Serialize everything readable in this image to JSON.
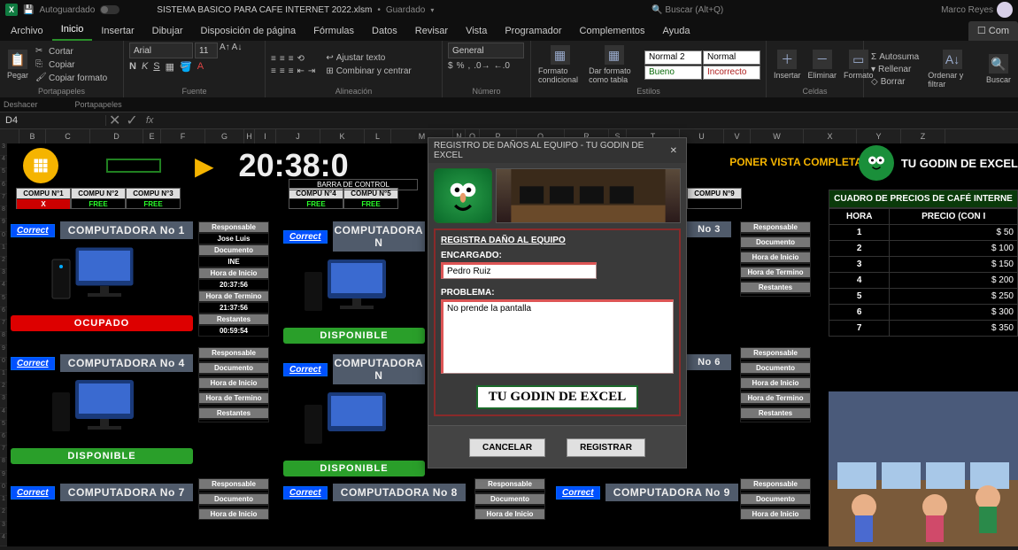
{
  "titlebar": {
    "autosave": "Autoguardado",
    "filename": "SISTEMA BASICO PARA CAFE INTERNET 2022.xlsm",
    "saved_state": "Guardado",
    "search_placeholder": "Buscar (Alt+Q)",
    "username": "Marco Reyes"
  },
  "tabs": [
    "Archivo",
    "Inicio",
    "Insertar",
    "Dibujar",
    "Disposición de página",
    "Fórmulas",
    "Datos",
    "Revisar",
    "Vista",
    "Programador",
    "Complementos",
    "Ayuda"
  ],
  "active_tab": "Inicio",
  "comments_btn": "Com",
  "ribbon": {
    "clipboard": {
      "paste": "Pegar",
      "cut": "Cortar",
      "copy": "Copiar",
      "format": "Copiar formato",
      "label": "Portapapeles"
    },
    "font": {
      "name": "Arial",
      "size": "11",
      "label": "Fuente"
    },
    "align": {
      "wrap": "Ajustar texto",
      "merge": "Combinar y centrar",
      "label": "Alineación"
    },
    "number": {
      "format": "General",
      "label": "Número"
    },
    "styles": {
      "cond": "Formato condicional",
      "table": "Dar formato como tabla",
      "s1": "Normal 2",
      "s2": "Normal",
      "s3": "Bueno",
      "s4": "Incorrecto",
      "label": "Estilos"
    },
    "cells": {
      "insert": "Insertar",
      "delete": "Eliminar",
      "format": "Formato",
      "label": "Celdas"
    },
    "editing": {
      "sum": "Autosuma",
      "fill": "Rellenar",
      "clear": "Borrar",
      "sort": "Ordenar y filtrar",
      "find": "Buscar",
      "label": ""
    }
  },
  "undo_label": "Deshacer",
  "namebox": "D4",
  "app": {
    "clock": "20:38:0",
    "view_full": "PONER VISTA COMPLETA",
    "brand": "TU GODIN DE EXCEL",
    "control_bar": "BARRA DE CONTROL",
    "correct_btn": "Correct",
    "status_ocupado": "OCUPADO",
    "status_disponible": "DISPONIBLE"
  },
  "compu_headers": [
    {
      "h": "COMPU N°1",
      "v": "X",
      "cls": "red"
    },
    {
      "h": "COMPU N°2",
      "v": "FREE",
      "cls": "grn"
    },
    {
      "h": "COMPU N°3",
      "v": "FREE",
      "cls": "grn"
    },
    {
      "h": "COMPU N°4",
      "v": "FREE",
      "cls": "grn"
    },
    {
      "h": "COMPU N°5",
      "v": "FREE",
      "cls": "grn"
    },
    {
      "h": "COMPU N°9",
      "v": "",
      "cls": ""
    }
  ],
  "sidebar_labels": [
    "Responsable",
    "Documento",
    "Hora de Inicio",
    "Hora de Termino",
    "Restantes"
  ],
  "pc1_side": {
    "resp": "Responsable",
    "resp_v": "Jose Luis",
    "doc": "Documento",
    "doc_v": "INE",
    "hi": "Hora de Inicio",
    "hi_v": "20:37:56",
    "ht": "Hora de Termino",
    "ht_v": "21:37:56",
    "rest": "Restantes",
    "rest_v": "00:59:54"
  },
  "panels": [
    {
      "title": "COMPUTADORA  No  1",
      "status": "OCUPADO"
    },
    {
      "title": "COMPUTADORA  N",
      "status": "DISPONIBLE"
    },
    {
      "title": "No  3",
      "status": ""
    },
    {
      "title": "COMPUTADORA  No  4",
      "status": "DISPONIBLE"
    },
    {
      "title": "COMPUTADORA  N",
      "status": "DISPONIBLE"
    },
    {
      "title": "No  6",
      "status": ""
    },
    {
      "title": "COMPUTADORA  No  7",
      "status": ""
    },
    {
      "title": "COMPUTADORA  No  8",
      "status": ""
    },
    {
      "title": "COMPUTADORA  No  9",
      "status": ""
    }
  ],
  "price_table": {
    "title": "CUADRO DE PRECIOS DE CAFÉ INTERNE",
    "col_hora": "HORA",
    "col_precio": "PRECIO (CON I",
    "rows": [
      {
        "h": "1",
        "p": "$                      50"
      },
      {
        "h": "2",
        "p": "$                    100"
      },
      {
        "h": "3",
        "p": "$                    150"
      },
      {
        "h": "4",
        "p": "$                    200"
      },
      {
        "h": "5",
        "p": "$                    250"
      },
      {
        "h": "6",
        "p": "$                    300"
      },
      {
        "h": "7",
        "p": "$                    350"
      }
    ]
  },
  "modal": {
    "title": "REGISTRO DE DAÑOS AL EQUIPO - TU GODIN DE EXCEL",
    "section": "REGISTRA DAÑO AL EQUIPO",
    "enc_label": "ENCARGADO:",
    "enc_value": "Pedro Ruiz",
    "prob_label": "PROBLEMA:",
    "prob_value": "No prende la pantalla",
    "brand": "TU GODIN DE EXCEL",
    "cancel": "CANCELAR",
    "register": "REGISTRAR"
  }
}
